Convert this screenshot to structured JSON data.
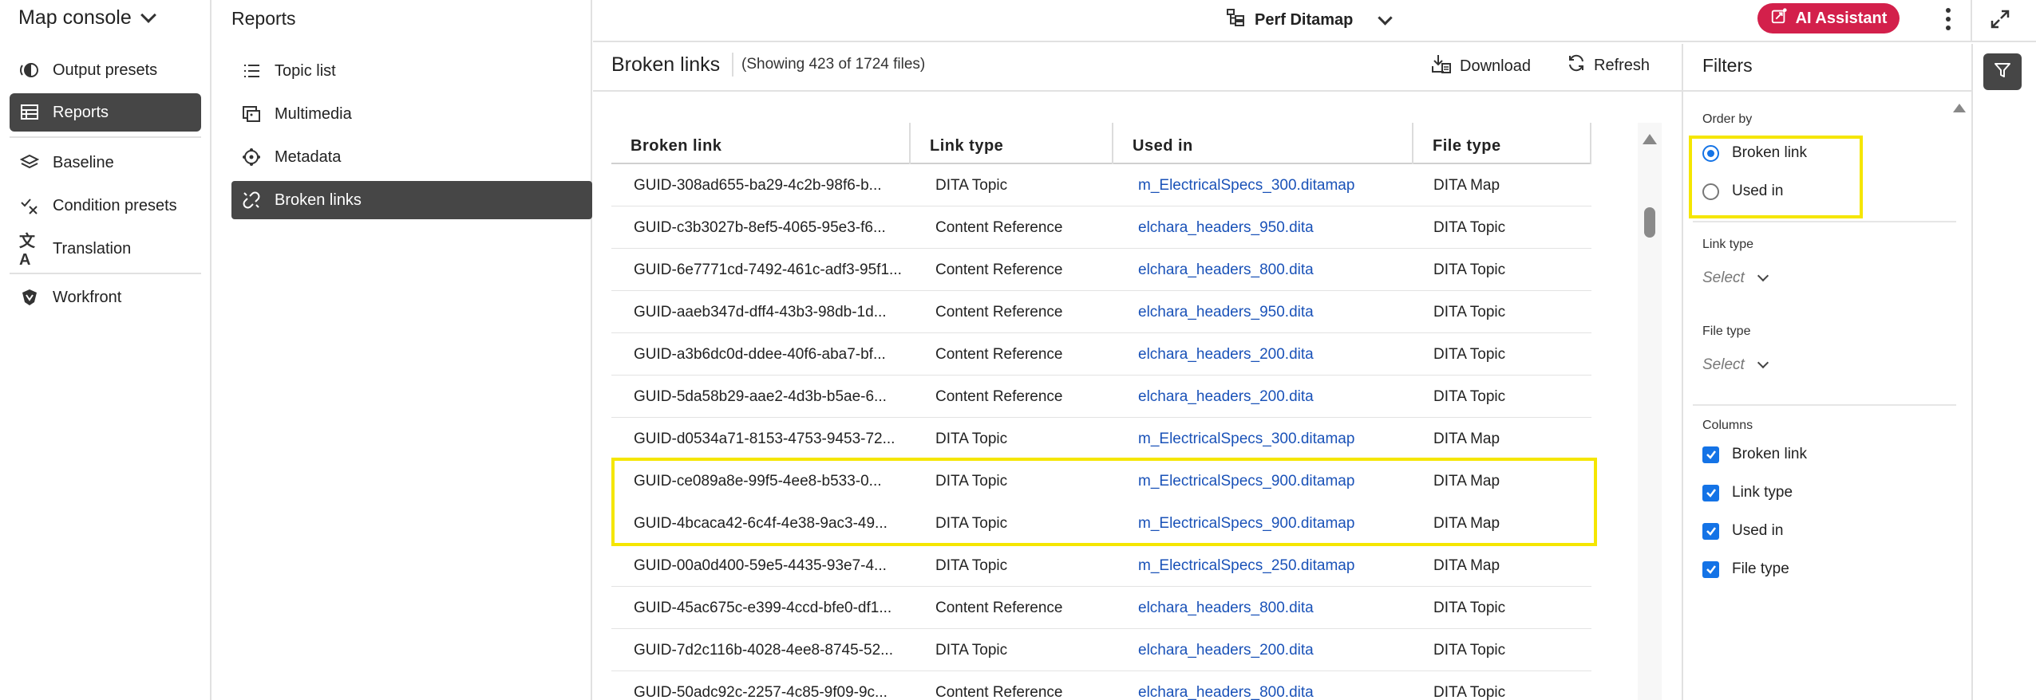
{
  "left_nav": {
    "title": "Map console",
    "items": [
      {
        "label": "Output presets",
        "icon": "output-presets-icon",
        "active": false
      },
      {
        "label": "Reports",
        "icon": "reports-icon",
        "active": true
      },
      {
        "label": "Baseline",
        "icon": "baseline-icon",
        "active": false
      },
      {
        "label": "Condition presets",
        "icon": "condition-presets-icon",
        "active": false
      },
      {
        "label": "Translation",
        "icon": "translation-icon",
        "active": false
      },
      {
        "label": "Workfront",
        "icon": "workfront-icon",
        "active": false
      }
    ]
  },
  "reports": {
    "heading": "Reports",
    "items": [
      {
        "label": "Topic list",
        "icon": "list-icon",
        "active": false
      },
      {
        "label": "Multimedia",
        "icon": "multimedia-icon",
        "active": false
      },
      {
        "label": "Metadata",
        "icon": "metadata-icon",
        "active": false
      },
      {
        "label": "Broken links",
        "icon": "broken-link-icon",
        "active": true
      }
    ]
  },
  "topbar": {
    "ditamap_title": "Perf Ditamap",
    "ai_assistant_label": "AI Assistant"
  },
  "content": {
    "title": "Broken links",
    "count_text": "(Showing 423 of 1724 files)",
    "download_label": "Download",
    "refresh_label": "Refresh"
  },
  "table": {
    "columns": [
      "Broken link",
      "Link type",
      "Used in",
      "File type"
    ],
    "rows": [
      [
        "GUID-308ad655-ba29-4c2b-98f6-b...",
        "DITA Topic",
        "m_ElectricalSpecs_300.ditamap",
        "DITA Map"
      ],
      [
        "GUID-c3b3027b-8ef5-4065-95e3-f6...",
        "Content Reference",
        "elchara_headers_950.dita",
        "DITA Topic"
      ],
      [
        "GUID-6e7771cd-7492-461c-adf3-95f1...",
        "Content Reference",
        "elchara_headers_800.dita",
        "DITA Topic"
      ],
      [
        "GUID-aaeb347d-dff4-43b3-98db-1d...",
        "Content Reference",
        "elchara_headers_950.dita",
        "DITA Topic"
      ],
      [
        "GUID-a3b6dc0d-ddee-40f6-aba7-bf...",
        "Content Reference",
        "elchara_headers_200.dita",
        "DITA Topic"
      ],
      [
        "GUID-5da58b29-aae2-4d3b-b5ae-6...",
        "Content Reference",
        "elchara_headers_200.dita",
        "DITA Topic"
      ],
      [
        "GUID-d0534a71-8153-4753-9453-72...",
        "DITA Topic",
        "m_ElectricalSpecs_300.ditamap",
        "DITA Map"
      ],
      [
        "GUID-ce089a8e-99f5-4ee8-b533-0...",
        "DITA Topic",
        "m_ElectricalSpecs_900.ditamap",
        "DITA Map"
      ],
      [
        "GUID-4bcaca42-6c4f-4e38-9ac3-49...",
        "DITA Topic",
        "m_ElectricalSpecs_900.ditamap",
        "DITA Map"
      ],
      [
        "GUID-00a0d400-59e5-4435-93e7-4...",
        "DITA Topic",
        "m_ElectricalSpecs_250.ditamap",
        "DITA Map"
      ],
      [
        "GUID-45ac675c-e399-4ccd-bfe0-df1...",
        "Content Reference",
        "elchara_headers_800.dita",
        "DITA Topic"
      ],
      [
        "GUID-7d2c116b-4028-4ee8-8745-52...",
        "DITA Topic",
        "elchara_headers_200.dita",
        "DITA Topic"
      ],
      [
        "GUID-50adc92c-2257-4c85-9f09-9c...",
        "Content Reference",
        "elchara_headers_800.dita",
        "DITA Topic"
      ]
    ]
  },
  "filters": {
    "title": "Filters",
    "order_by_label": "Order by",
    "order_by_options": [
      {
        "label": "Broken link",
        "selected": true
      },
      {
        "label": "Used in",
        "selected": false
      }
    ],
    "link_type_label": "Link type",
    "link_type_value": "Select",
    "file_type_label": "File type",
    "file_type_value": "Select",
    "columns_label": "Columns",
    "columns": [
      {
        "label": "Broken link",
        "checked": true
      },
      {
        "label": "Link type",
        "checked": true
      },
      {
        "label": "Used in",
        "checked": true
      },
      {
        "label": "File type",
        "checked": true
      }
    ]
  },
  "colors": {
    "accent": "#1473e6",
    "ai_button": "#d3204b",
    "active_nav": "#464646",
    "link": "#1a52b8",
    "highlight": "#f5e600"
  }
}
